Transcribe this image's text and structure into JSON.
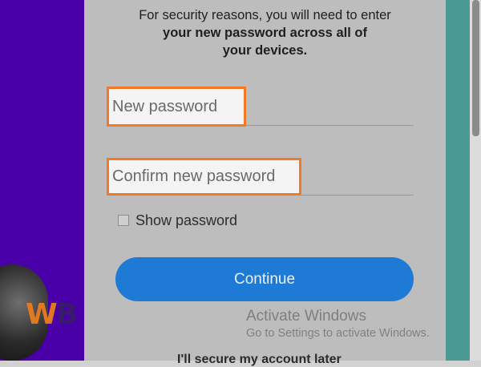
{
  "message": {
    "line1": "For security reasons, you will need to enter",
    "line2": "your new password across all of",
    "line3": "your devices."
  },
  "fields": {
    "new_password_placeholder": "New password",
    "confirm_password_placeholder": "Confirm new password"
  },
  "show_password": {
    "label": "Show password",
    "checked": false
  },
  "continue_label": "Continue",
  "skip_label": "I'll secure my account later",
  "watermark": {
    "title": "Activate Windows",
    "subtitle": "Go to Settings to activate Windows."
  },
  "colors": {
    "accent": "#1f7ad6",
    "highlight": "#f07a26",
    "left_background": "#4a00a8",
    "right_background": "#4c9a94"
  }
}
